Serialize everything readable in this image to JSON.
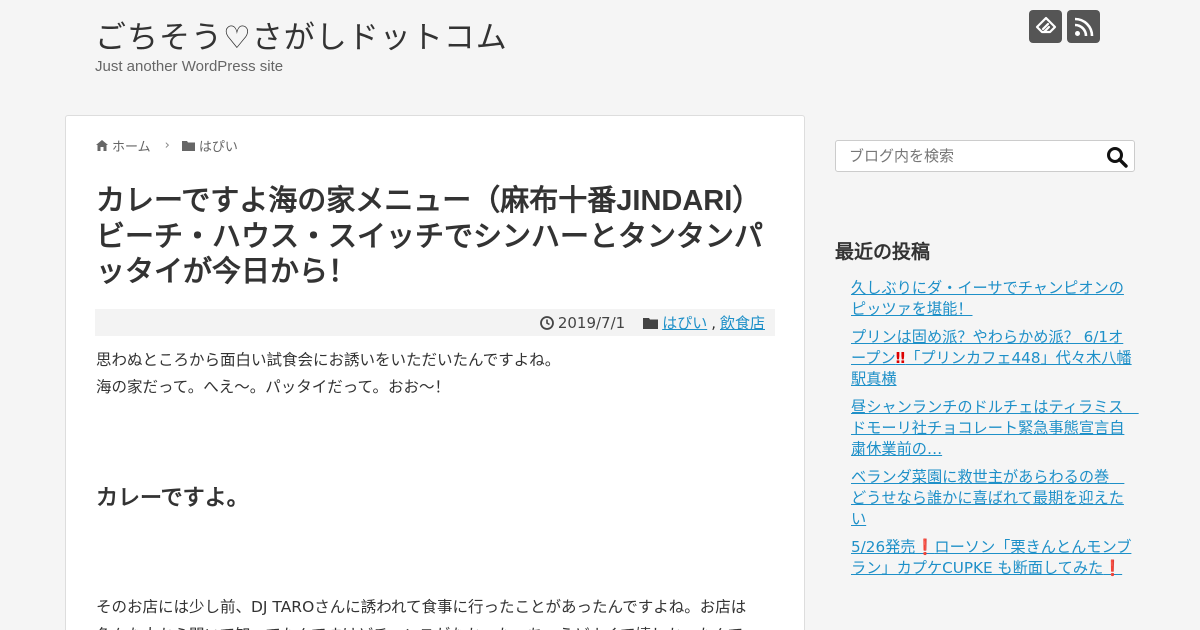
{
  "site": {
    "title": "ごちそう♡さがしドットコム",
    "description": "Just another WordPress site"
  },
  "header_icons": [
    "feedly-icon",
    "rss-icon"
  ],
  "breadcrumb": {
    "home": "ホーム",
    "category": "はぴい"
  },
  "article": {
    "title": "カレーですよ海の家メニュー（麻布十番JINDARI）ビーチ・ハウス・スイッチでシンハーとタンタンパッタイが今日から！",
    "date": "2019/7/1",
    "categories": [
      "はぴい",
      "飲食店"
    ],
    "paragraph1_line1": "思わぬところから面白い試食会にお誘いをいただいたんですよね。",
    "paragraph1_line2": "海の家だって。へえ～。パッタイだって。おお～！",
    "subheading": "カレーですよ。",
    "paragraph2_line1": "そのお店には少し前、DJ TAROさんに誘われて食事に行ったことがあったんですよね。お店は",
    "paragraph2_line2": "色々な人から聞いて知ってたんですけどチャンスがなかった。ちょうどよくて嬉しかったんで"
  },
  "sidebar": {
    "search_placeholder": "ブログ内を検索",
    "recent_heading": "最近の投稿",
    "recent_posts": [
      {
        "text": "久しぶりにダ・イーサでチャンピオンのピッツァを堪能！"
      },
      {
        "text_a": "プリンは固め派？やわらかめ派？ 6/1オープン",
        "mark": "‼",
        "text_b": "「プリンカフェ448」代々木八幡 駅真横"
      },
      {
        "text": "昼シャンランチのドルチェはティラミス　ドモーリ社チョコレート緊急事態宣言自粛休業前の…"
      },
      {
        "text": "ベランダ菜園に救世主があらわるの巻　どうせなら誰かに喜ばれて最期を迎えたい"
      },
      {
        "text_a": "5/26発売",
        "mark": "❗",
        "text_b": "ローソン「栗きんとんモンブラン」カプケCUPKE も断面してみた",
        "mark2": "❗"
      }
    ]
  },
  "colors": {
    "link": "#1e90c8",
    "background": "#f5f5f5",
    "icon_bg": "#555555",
    "exclamation": "#dd0000"
  }
}
